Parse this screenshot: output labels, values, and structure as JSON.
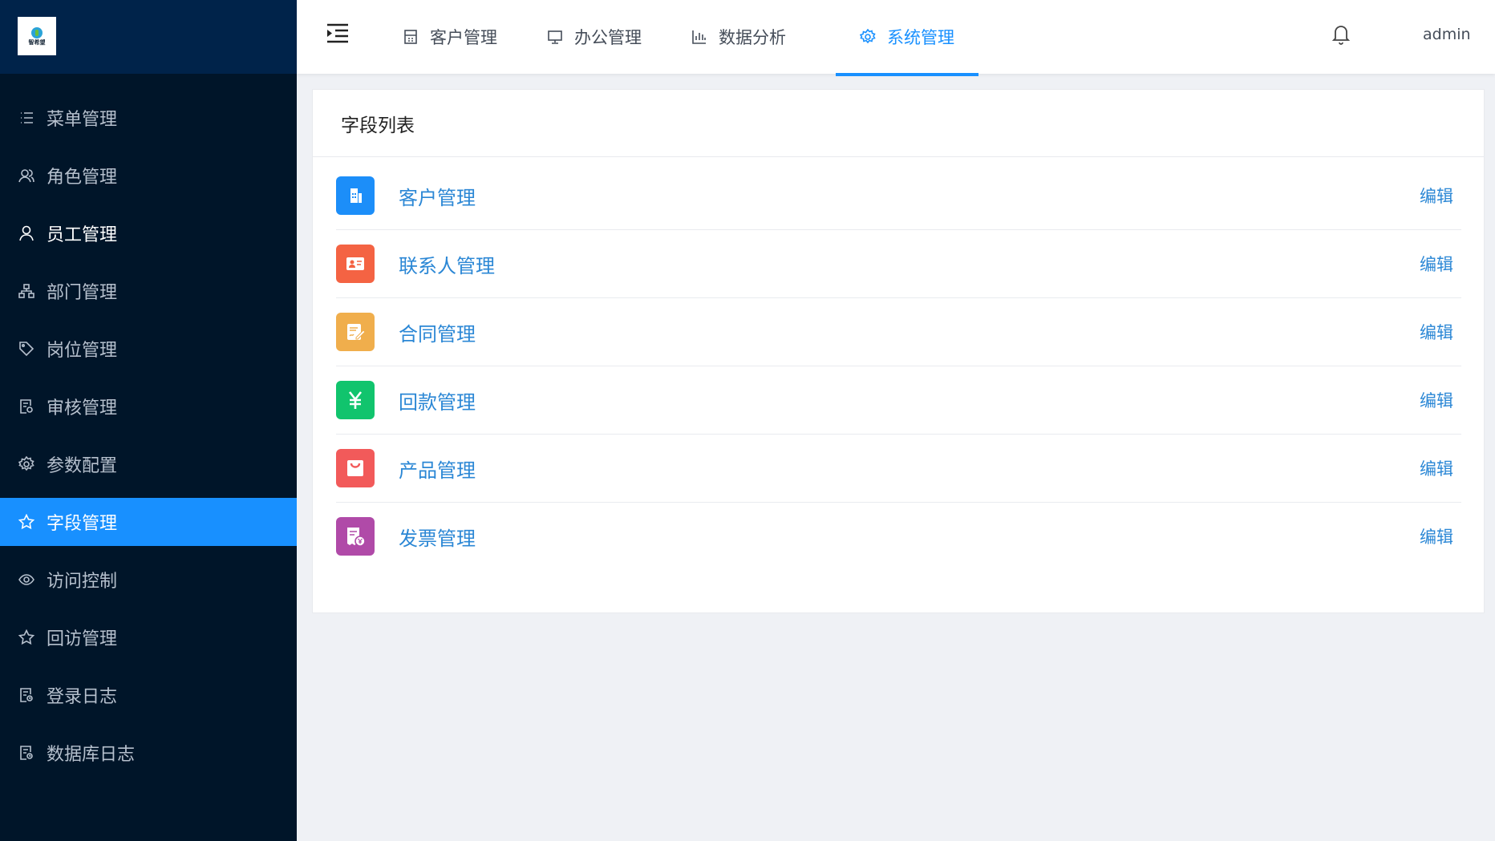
{
  "logo": {
    "text": "智希望",
    "sub": ""
  },
  "sidebar": {
    "items": [
      {
        "label": "菜单管理",
        "icon": "list-icon",
        "state": "normal"
      },
      {
        "label": "角色管理",
        "icon": "users-icon",
        "state": "normal"
      },
      {
        "label": "员工管理",
        "icon": "user-icon",
        "state": "hover"
      },
      {
        "label": "部门管理",
        "icon": "org-chart-icon",
        "state": "normal"
      },
      {
        "label": "岗位管理",
        "icon": "tag-icon",
        "state": "normal"
      },
      {
        "label": "审核管理",
        "icon": "audit-doc-icon",
        "state": "normal"
      },
      {
        "label": "参数配置",
        "icon": "gear-icon",
        "state": "normal"
      },
      {
        "label": "字段管理",
        "icon": "star-icon",
        "state": "active"
      },
      {
        "label": "访问控制",
        "icon": "eye-icon",
        "state": "normal"
      },
      {
        "label": "回访管理",
        "icon": "star-icon",
        "state": "normal"
      },
      {
        "label": "登录日志",
        "icon": "log-doc-icon",
        "state": "normal"
      },
      {
        "label": "数据库日志",
        "icon": "log-doc-icon",
        "state": "normal"
      }
    ]
  },
  "header": {
    "tabs": [
      {
        "label": "客户管理",
        "icon": "building-icon"
      },
      {
        "label": "办公管理",
        "icon": "monitor-icon"
      },
      {
        "label": "数据分析",
        "icon": "bar-chart-icon"
      },
      {
        "label": "系统管理",
        "icon": "gear-icon",
        "active": true
      }
    ],
    "user": "admin"
  },
  "card": {
    "title": "字段列表",
    "edit_label": "编辑",
    "fields": [
      {
        "label": "客户管理",
        "icon": "customer-icon",
        "color": "#1c8ef9"
      },
      {
        "label": "联系人管理",
        "icon": "contact-card-icon",
        "color": "#f46343"
      },
      {
        "label": "合同管理",
        "icon": "contract-icon",
        "color": "#f0ae4c"
      },
      {
        "label": "回款管理",
        "icon": "yen-icon",
        "color": "#11c46d"
      },
      {
        "label": "产品管理",
        "icon": "shopping-bag-icon",
        "color": "#f25a5a"
      },
      {
        "label": "发票管理",
        "icon": "invoice-icon",
        "color": "#b04aa8"
      }
    ]
  },
  "colors": {
    "accent": "#1890ff",
    "sidebar_bg": "#001529",
    "link": "#2b87d5"
  }
}
